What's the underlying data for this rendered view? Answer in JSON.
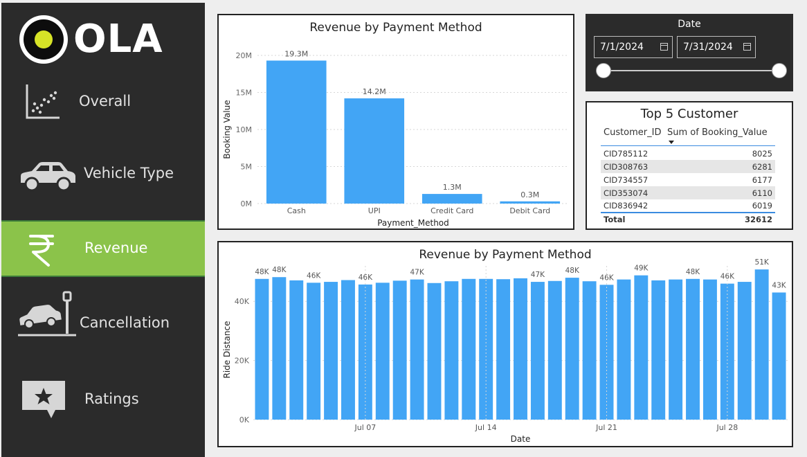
{
  "brand": {
    "name": "OLA"
  },
  "nav": {
    "items": [
      {
        "label": "Overall",
        "icon": "scatter-chart-icon"
      },
      {
        "label": "Vehicle Type",
        "icon": "car-icon"
      },
      {
        "label": "Revenue",
        "icon": "rupee-icon"
      },
      {
        "label": "Cancellation",
        "icon": "car-crash-icon"
      },
      {
        "label": "Ratings",
        "icon": "star-icon"
      }
    ],
    "active": "Revenue"
  },
  "colors": {
    "bar": "#42a5f5",
    "active_nav": "#8bc34a",
    "sidebar": "#2b2b2b"
  },
  "date_slicer": {
    "label": "Date",
    "start": "7/1/2024",
    "end": "7/31/2024"
  },
  "top_customers": {
    "title": "Top 5 Customer",
    "columns": [
      "Customer_ID",
      "Sum of Booking_Value"
    ],
    "rows": [
      {
        "id": "CID785112",
        "value": "8025"
      },
      {
        "id": "CID308763",
        "value": "6281"
      },
      {
        "id": "CID734557",
        "value": "6177"
      },
      {
        "id": "CID353074",
        "value": "6110"
      },
      {
        "id": "CID836942",
        "value": "6019"
      }
    ],
    "total_label": "Total",
    "total_value": "32612"
  },
  "chart_data": [
    {
      "type": "bar",
      "title": "Revenue by Payment Method",
      "xlabel": "Payment_Method",
      "ylabel": "Booking Value",
      "categories": [
        "Cash",
        "UPI",
        "Credit Card",
        "Debit Card"
      ],
      "values": [
        19.3,
        14.2,
        1.3,
        0.3
      ],
      "value_labels": [
        "19.3M",
        "14.2M",
        "1.3M",
        "0.3M"
      ],
      "unit": "M",
      "yticks": [
        "0M",
        "5M",
        "10M",
        "15M",
        "20M"
      ],
      "ylim": [
        0,
        20
      ],
      "grid": true
    },
    {
      "type": "bar",
      "title": "Revenue by Payment Method",
      "xlabel": "Date",
      "ylabel": "Ride Distance",
      "x": [
        "Jul 01",
        "Jul 02",
        "Jul 03",
        "Jul 04",
        "Jul 05",
        "Jul 06",
        "Jul 07",
        "Jul 08",
        "Jul 09",
        "Jul 10",
        "Jul 11",
        "Jul 12",
        "Jul 13",
        "Jul 14",
        "Jul 15",
        "Jul 16",
        "Jul 17",
        "Jul 18",
        "Jul 19",
        "Jul 20",
        "Jul 21",
        "Jul 22",
        "Jul 23",
        "Jul 24",
        "Jul 25",
        "Jul 26",
        "Jul 27",
        "Jul 28",
        "Jul 29",
        "Jul 30",
        "Jul 31"
      ],
      "values": [
        47.6,
        48.2,
        47.1,
        46.3,
        46.6,
        47.2,
        45.7,
        46.3,
        47.0,
        47.4,
        46.2,
        46.8,
        47.6,
        47.6,
        47.5,
        47.8,
        46.6,
        46.9,
        48.0,
        46.8,
        45.6,
        47.4,
        48.8,
        47.1,
        47.4,
        47.6,
        47.4,
        46.0,
        46.6,
        50.8,
        43.0
      ],
      "value_labels": [
        "48K",
        "48K",
        "",
        "46K",
        "",
        "",
        "46K",
        "",
        "",
        "47K",
        "",
        "",
        "",
        "",
        "",
        "",
        "47K",
        "",
        "48K",
        "",
        "46K",
        "",
        "49K",
        "",
        "",
        "48K",
        "",
        "46K",
        "",
        "51K",
        "43K"
      ],
      "xticks": [
        "Jul 07",
        "Jul 14",
        "Jul 21",
        "Jul 28"
      ],
      "yticks": [
        "0K",
        "20K",
        "40K"
      ],
      "ylim": [
        0,
        52
      ],
      "grid": true
    }
  ]
}
